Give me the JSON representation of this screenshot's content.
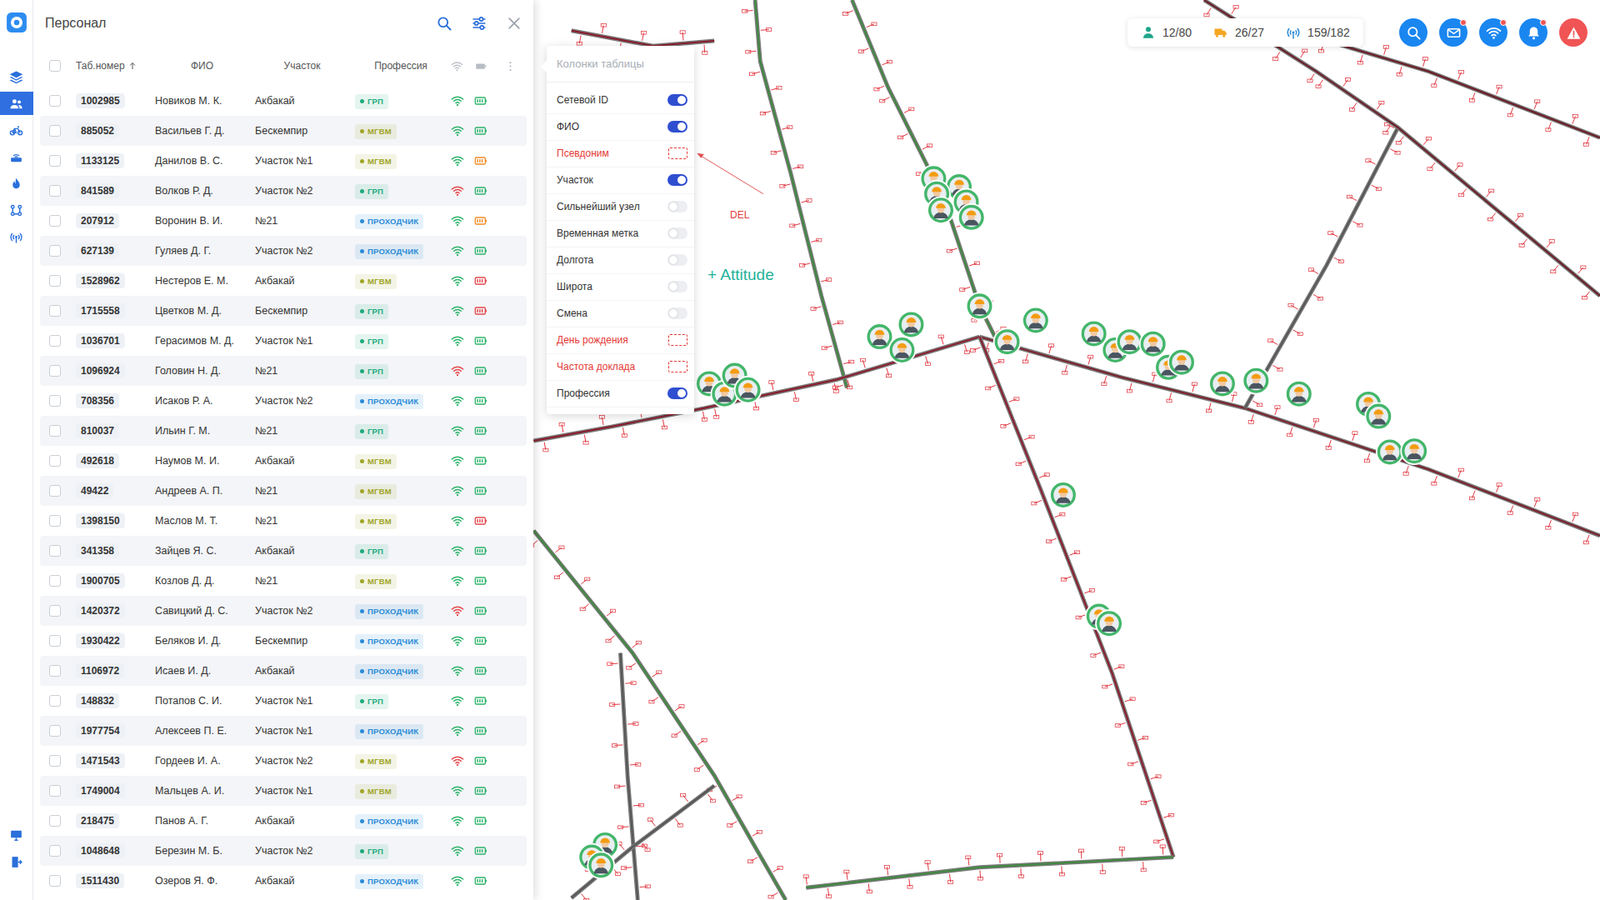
{
  "sidebar": {
    "items": [
      {
        "selected": false
      },
      {
        "selected": true
      },
      {
        "selected": false
      },
      {
        "selected": false
      },
      {
        "selected": false
      },
      {
        "selected": false
      },
      {
        "selected": false
      }
    ],
    "bottom_items": [
      {
        "selected": false
      },
      {
        "selected": false
      }
    ]
  },
  "panel": {
    "title": "Персонал"
  },
  "table": {
    "header_checked": false,
    "columns": [
      {
        "label": "Таб.номер",
        "sorted": true
      },
      {
        "label": "ФИО",
        "sorted": false
      },
      {
        "label": "Участок",
        "sorted": false
      },
      {
        "label": "Профессия",
        "sorted": false
      }
    ],
    "rows": [
      {
        "checked": false,
        "tab": "1002985",
        "name": "Новиков М. К.",
        "section": "Акбакай",
        "profession": "ГРП",
        "profession_color": "#1ea97c",
        "signal_color": "#2fb36c",
        "battery_color": "#2fb36c"
      },
      {
        "checked": false,
        "tab": "885052",
        "name": "Васильев Г. Д.",
        "section": "Бескемпир",
        "profession": "МГВМ",
        "profession_color": "#a0a428",
        "signal_color": "#2fb36c",
        "battery_color": "#2fb36c"
      },
      {
        "checked": false,
        "tab": "1133125",
        "name": "Данилов В. С.",
        "section": "Участок №1",
        "profession": "МГВМ",
        "profession_color": "#a0a428",
        "signal_color": "#2fb36c",
        "battery_color": "#f28c28"
      },
      {
        "checked": false,
        "tab": "841589",
        "name": "Волков Р. Д.",
        "section": "Участок №2",
        "profession": "ГРП",
        "profession_color": "#1ea97c",
        "signal_color": "#e5484d",
        "battery_color": "#2fb36c"
      },
      {
        "checked": false,
        "tab": "207912",
        "name": "Воронин В. И.",
        "section": "№21",
        "profession": "ПРОХОДЧИК",
        "profession_color": "#2a8bd8",
        "signal_color": "#2fb36c",
        "battery_color": "#f28c28"
      },
      {
        "checked": false,
        "tab": "627139",
        "name": "Гуляев Д. Г.",
        "section": "Участок №2",
        "profession": "ПРОХОДЧИК",
        "profession_color": "#2a8bd8",
        "signal_color": "#2fb36c",
        "battery_color": "#2fb36c"
      },
      {
        "checked": false,
        "tab": "1528962",
        "name": "Нестеров Е. М.",
        "section": "Акбакай",
        "profession": "МГВМ",
        "profession_color": "#a0a428",
        "signal_color": "#2fb36c",
        "battery_color": "#e5484d"
      },
      {
        "checked": false,
        "tab": "1715558",
        "name": "Цветков М. Д.",
        "section": "Бескемпир",
        "profession": "ГРП",
        "profession_color": "#1ea97c",
        "signal_color": "#2fb36c",
        "battery_color": "#e5484d"
      },
      {
        "checked": false,
        "tab": "1036701",
        "name": "Герасимов М. Д.",
        "section": "Участок №1",
        "profession": "ГРП",
        "profession_color": "#1ea97c",
        "signal_color": "#2fb36c",
        "battery_color": "#2fb36c"
      },
      {
        "checked": false,
        "tab": "1096924",
        "name": "Головин Н. Д.",
        "section": "№21",
        "profession": "ГРП",
        "profession_color": "#1ea97c",
        "signal_color": "#e5484d",
        "battery_color": "#2fb36c"
      },
      {
        "checked": false,
        "tab": "708356",
        "name": "Исаков Р. А.",
        "section": "Участок №2",
        "profession": "ПРОХОДЧИК",
        "profession_color": "#2a8bd8",
        "signal_color": "#2fb36c",
        "battery_color": "#2fb36c"
      },
      {
        "checked": false,
        "tab": "810037",
        "name": "Ильин Г. М.",
        "section": "№21",
        "profession": "ГРП",
        "profession_color": "#1ea97c",
        "signal_color": "#2fb36c",
        "battery_color": "#2fb36c"
      },
      {
        "checked": false,
        "tab": "492618",
        "name": "Наумов М. И.",
        "section": "Акбакай",
        "profession": "МГВМ",
        "profession_color": "#a0a428",
        "signal_color": "#2fb36c",
        "battery_color": "#2fb36c"
      },
      {
        "checked": false,
        "tab": "49422",
        "name": "Андреев А. П.",
        "section": "№21",
        "profession": "МГВМ",
        "profession_color": "#a0a428",
        "signal_color": "#2fb36c",
        "battery_color": "#2fb36c"
      },
      {
        "checked": false,
        "tab": "1398150",
        "name": "Маслов М. Т.",
        "section": "№21",
        "profession": "МГВМ",
        "profession_color": "#a0a428",
        "signal_color": "#2fb36c",
        "battery_color": "#e5484d"
      },
      {
        "checked": false,
        "tab": "341358",
        "name": "Зайцев Я. С.",
        "section": "Акбакай",
        "profession": "ГРП",
        "profession_color": "#1ea97c",
        "signal_color": "#2fb36c",
        "battery_color": "#2fb36c"
      },
      {
        "checked": false,
        "tab": "1900705",
        "name": "Козлов Д. Д.",
        "section": "№21",
        "profession": "МГВМ",
        "profession_color": "#a0a428",
        "signal_color": "#2fb36c",
        "battery_color": "#2fb36c"
      },
      {
        "checked": false,
        "tab": "1420372",
        "name": "Савицкий Д. С.",
        "section": "Участок №2",
        "profession": "ПРОХОДЧИК",
        "profession_color": "#2a8bd8",
        "signal_color": "#e5484d",
        "battery_color": "#2fb36c"
      },
      {
        "checked": false,
        "tab": "1930422",
        "name": "Беляков И. Д.",
        "section": "Бескемпир",
        "profession": "ПРОХОДЧИК",
        "profession_color": "#2a8bd8",
        "signal_color": "#2fb36c",
        "battery_color": "#2fb36c"
      },
      {
        "checked": false,
        "tab": "1106972",
        "name": "Исаев И. Д.",
        "section": "Акбакай",
        "profession": "ПРОХОДЧИК",
        "profession_color": "#2a8bd8",
        "signal_color": "#2fb36c",
        "battery_color": "#2fb36c"
      },
      {
        "checked": false,
        "tab": "148832",
        "name": "Потапов С. И.",
        "section": "Участок №1",
        "profession": "ГРП",
        "profession_color": "#1ea97c",
        "signal_color": "#2fb36c",
        "battery_color": "#2fb36c"
      },
      {
        "checked": false,
        "tab": "1977754",
        "name": "Алексеев П. Е.",
        "section": "Участок №1",
        "profession": "ПРОХОДЧИК",
        "profession_color": "#2a8bd8",
        "signal_color": "#2fb36c",
        "battery_color": "#2fb36c"
      },
      {
        "checked": false,
        "tab": "1471543",
        "name": "Гордеев И. А.",
        "section": "Участок №2",
        "profession": "МГВМ",
        "profession_color": "#a0a428",
        "signal_color": "#e5484d",
        "battery_color": "#2fb36c"
      },
      {
        "checked": false,
        "tab": "1749004",
        "name": "Мальцев А. И.",
        "section": "Участок №1",
        "profession": "МГВМ",
        "profession_color": "#a0a428",
        "signal_color": "#2fb36c",
        "battery_color": "#2fb36c"
      },
      {
        "checked": false,
        "tab": "218475",
        "name": "Панов А. Г.",
        "section": "Акбакай",
        "profession": "ПРОХОДЧИК",
        "profession_color": "#2a8bd8",
        "signal_color": "#2fb36c",
        "battery_color": "#2fb36c"
      },
      {
        "checked": false,
        "tab": "1048648",
        "name": "Березин М. Б.",
        "section": "Участок №2",
        "profession": "ГРП",
        "profession_color": "#1ea97c",
        "signal_color": "#2fb36c",
        "battery_color": "#2fb36c"
      },
      {
        "checked": false,
        "tab": "1511430",
        "name": "Озеров Я. Ф.",
        "section": "Акбакай",
        "profession": "ПРОХОДЧИК",
        "profession_color": "#2a8bd8",
        "signal_color": "#2fb36c",
        "battery_color": "#2fb36c"
      }
    ]
  },
  "column_menu": {
    "title": "Колонки таблицы",
    "items": [
      {
        "label": "Сетевой ID",
        "kind": "toggle",
        "on": true
      },
      {
        "label": "ФИО",
        "kind": "toggle",
        "on": true
      },
      {
        "label": "Псевдоним",
        "kind": "removed"
      },
      {
        "label": "Участок",
        "kind": "toggle",
        "on": true
      },
      {
        "label": "Сильнейший узел",
        "kind": "toggle",
        "on": false
      },
      {
        "label": "Временная метка",
        "kind": "toggle",
        "on": false
      },
      {
        "label": "Долгота",
        "kind": "toggle",
        "on": false
      },
      {
        "label": "Широта",
        "kind": "toggle",
        "on": false
      },
      {
        "label": "Смена",
        "kind": "toggle",
        "on": false
      },
      {
        "label": "День рождения",
        "kind": "removed"
      },
      {
        "label": "Частота доклада",
        "kind": "removed"
      },
      {
        "label": "Профессия",
        "kind": "toggle",
        "on": true
      }
    ]
  },
  "annotations": [
    {
      "text": "DEL",
      "color": "#e0403c"
    },
    {
      "text": "+ Attitude",
      "color": "#1fb29a"
    }
  ],
  "stats": [
    {
      "value": "12/80",
      "color": "#1fa58a"
    },
    {
      "value": "26/27",
      "color": "#f5a623"
    },
    {
      "value": "159/182",
      "color": "#2a8bd8"
    }
  ],
  "actions": [
    {
      "badge": false,
      "color": "#1a86f0"
    },
    {
      "badge": true,
      "color": "#1a86f0"
    },
    {
      "badge": true,
      "color": "#1a86f0"
    },
    {
      "badge": true,
      "color": "#1a86f0"
    },
    {
      "badge": false,
      "color": "#f05454"
    }
  ]
}
